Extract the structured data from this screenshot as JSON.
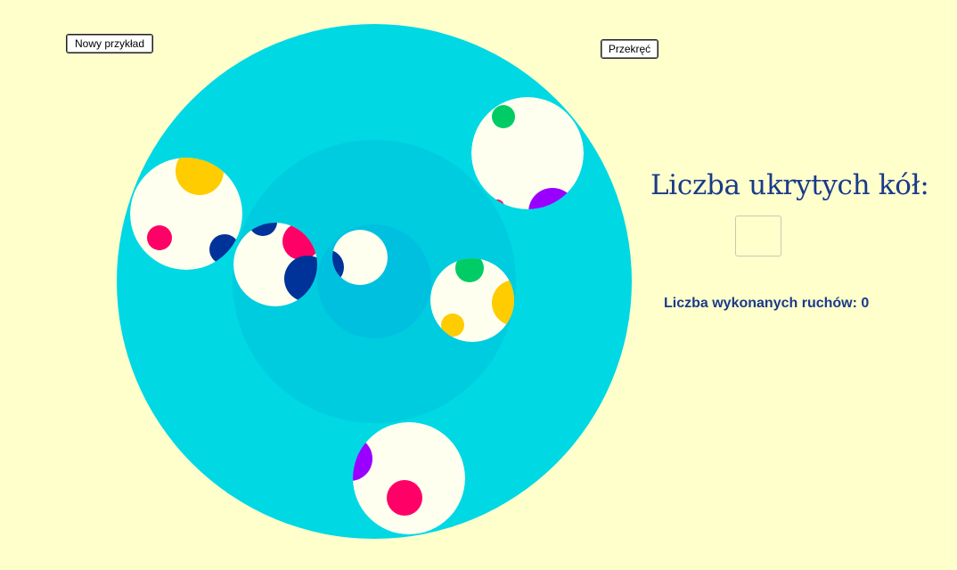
{
  "buttons": {
    "new_example": "Nowy przykład",
    "rotate": "Przekręć"
  },
  "panel": {
    "hidden_circles_label": "Liczba ukrytych kół:",
    "answer_value": "",
    "moves_label": "Liczba wykonanych ruchów:",
    "moves_count": "0"
  },
  "colors": {
    "background": "#ffffcc",
    "ring_outer": "#00d8e4",
    "ring_middle": "#00cce0",
    "ring_inner": "#00c0e0",
    "disc": "#fffff0",
    "text": "#1a3a8a",
    "pink": "#ff0066",
    "yellow": "#ffcc00",
    "navy": "#003399",
    "green": "#00cc66",
    "purple": "#9900ff"
  }
}
